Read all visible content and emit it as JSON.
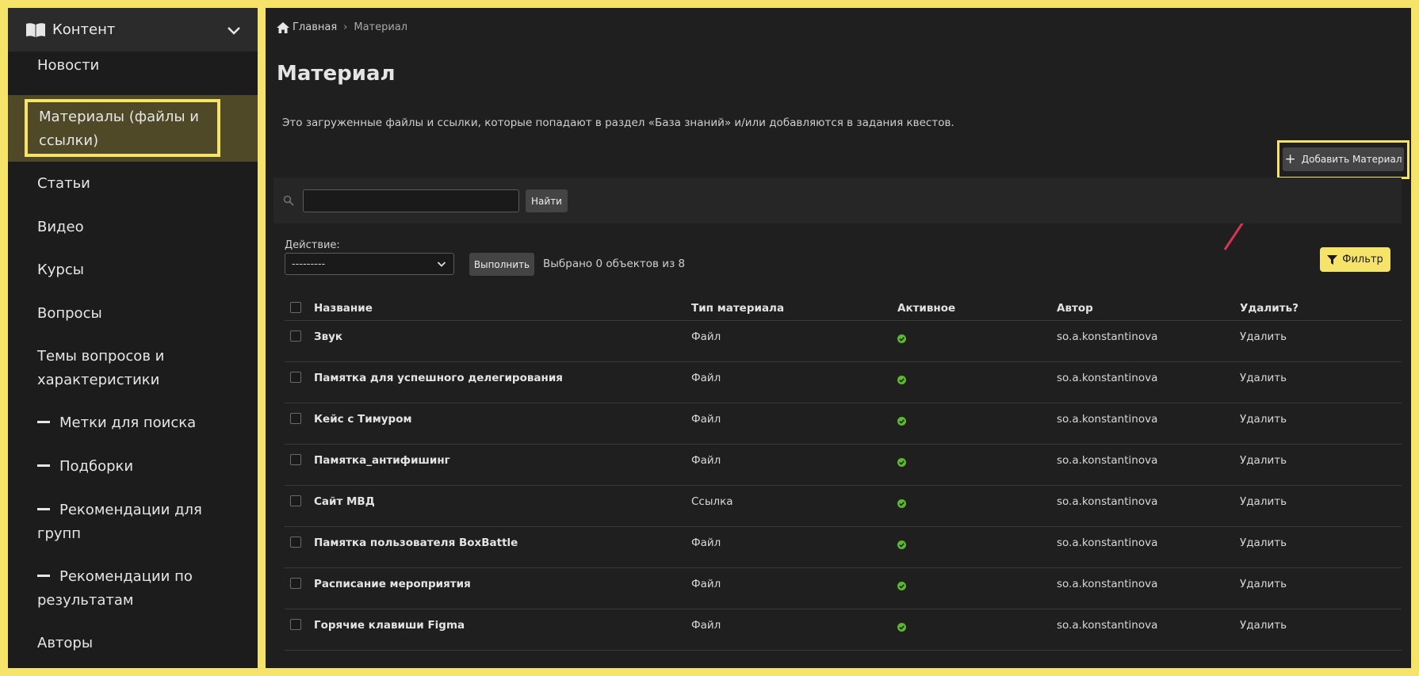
{
  "sidebar": {
    "header": "Контент",
    "items": [
      {
        "label": "Новости"
      },
      {
        "label_lines": [
          "Материалы (файлы и",
          "ссылки)"
        ]
      },
      {
        "label": "Статьи"
      },
      {
        "label": "Видео"
      },
      {
        "label": "Курсы"
      },
      {
        "label": "Вопросы"
      },
      {
        "label_lines": [
          "Темы вопросов и",
          "характеристики"
        ]
      },
      {
        "label": "Метки для поиска"
      },
      {
        "label": "Подборки"
      },
      {
        "label_lines": [
          "Рекомендации для",
          "групп"
        ]
      },
      {
        "label_lines": [
          "Рекомендации по",
          "результатам"
        ]
      },
      {
        "label": "Авторы"
      }
    ]
  },
  "breadcrumb": {
    "home": "Главная",
    "current": "Материал"
  },
  "page": {
    "title": "Материал",
    "description": "Это загруженные файлы и ссылки, которые попадают в раздел «База знаний» и/или добавляются в задания квестов."
  },
  "toolbar": {
    "add_label": "Добавить Материал",
    "search_value": "",
    "search_button": "Найти",
    "action_label": "Действие:",
    "action_selected": "---------",
    "run_button": "Выполнить",
    "selected_count": "Выбрано 0 объектов из 8",
    "filter_button": "Фильтр"
  },
  "table": {
    "columns": [
      "Название",
      "Тип материала",
      "Активное",
      "Автор",
      "Удалить?"
    ],
    "rows": [
      {
        "name": "Звук",
        "type": "Файл",
        "author": "so.a.konstantinova",
        "delete": "Удалить"
      },
      {
        "name": "Памятка для успешного делегирования",
        "type": "Файл",
        "author": "so.a.konstantinova",
        "delete": "Удалить"
      },
      {
        "name": "Кейс с Тимуром",
        "type": "Файл",
        "author": "so.a.konstantinova",
        "delete": "Удалить"
      },
      {
        "name": "Памятка_антифишинг",
        "type": "Файл",
        "author": "so.a.konstantinova",
        "delete": "Удалить"
      },
      {
        "name": "Сайт МВД",
        "type": "Ссылка",
        "author": "so.a.konstantinova",
        "delete": "Удалить"
      },
      {
        "name": "Памятка пользователя BoxBattle",
        "type": "Файл",
        "author": "so.a.konstantinova",
        "delete": "Удалить"
      },
      {
        "name": "Расписание мероприятия",
        "type": "Файл",
        "author": "so.a.konstantinova",
        "delete": "Удалить"
      },
      {
        "name": "Горячие клавиши Figma",
        "type": "Файл",
        "author": "so.a.konstantinova",
        "delete": "Удалить"
      }
    ]
  },
  "colors": {
    "accent": "#f5e36a",
    "active_check": "#5cb82e",
    "arrow": "#d6354f"
  }
}
